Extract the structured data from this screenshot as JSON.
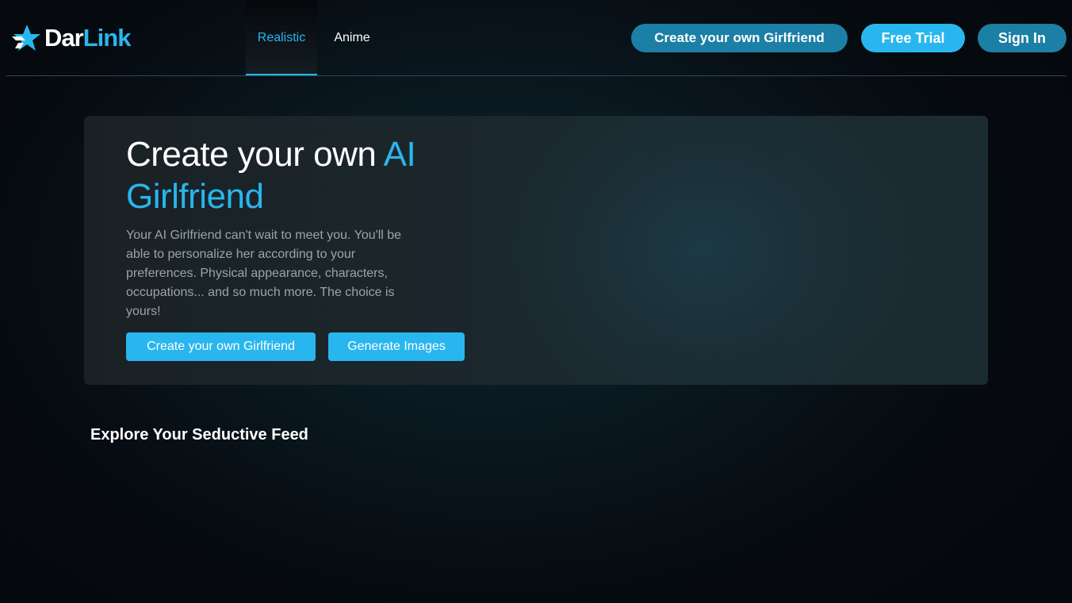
{
  "header": {
    "logo": {
      "prefix": "Dar",
      "suffix": "Link",
      "icon": "star-icon"
    },
    "nav": [
      {
        "label": "Realistic",
        "active": true
      },
      {
        "label": "Anime",
        "active": false
      }
    ],
    "create_label": "Create your own Girlfriend",
    "free_trial_label": "Free Trial",
    "sign_in_label": "Sign In"
  },
  "hero": {
    "title_part1": "Create your own ",
    "title_part2": "AI Girlfriend",
    "description": "Your AI Girlfriend can't wait to meet you. You'll be able to personalize her according to your preferences. Physical appearance, characters, occupations... and so much more. The choice is yours!",
    "create_button": "Create your own Girlfriend",
    "generate_button": "Generate Images"
  },
  "feed": {
    "title": "Explore Your Seductive Feed"
  },
  "colors": {
    "accent": "#29b6ee",
    "button_dark": "#1c7fa6",
    "background": "#05090d"
  }
}
